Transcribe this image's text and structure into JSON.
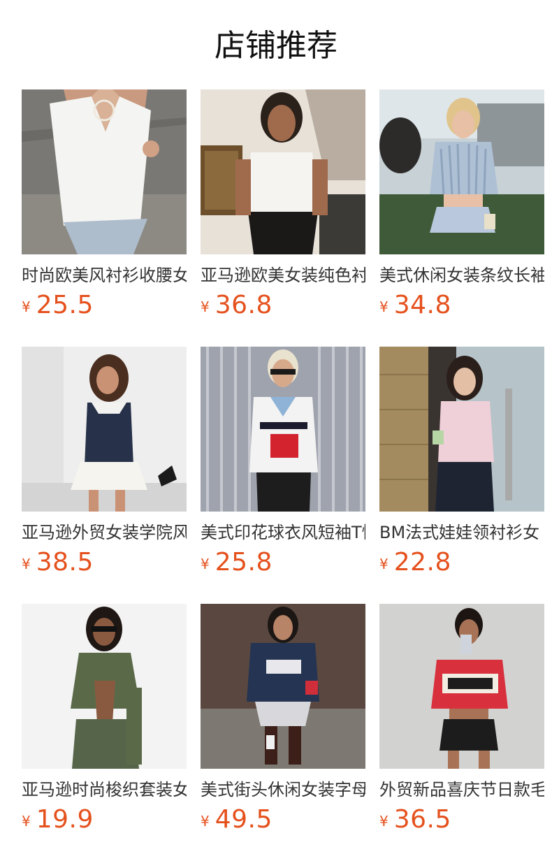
{
  "section_title": "店铺推荐",
  "currency_symbol": "¥",
  "products": [
    {
      "name": "时尚欧美风衬衫收腰女装",
      "price": "25.5",
      "image_icon": "product-photo-white-shirt"
    },
    {
      "name": "亚马逊欧美女装纯色衬衫",
      "price": "36.8",
      "image_icon": "product-photo-white-blouse"
    },
    {
      "name": "美式休闲女装条纹长袖衬衫",
      "price": "34.8",
      "image_icon": "product-photo-striped-shirt"
    },
    {
      "name": "亚马逊外贸女装学院风连衣裙",
      "price": "38.5",
      "image_icon": "product-photo-navy-dress"
    },
    {
      "name": "美式印花球衣风短袖T恤",
      "price": "25.8",
      "image_icon": "product-photo-jersey-tee"
    },
    {
      "name": "BM法式娃娃领衬衫女",
      "price": "22.8",
      "image_icon": "product-photo-pink-shirt"
    },
    {
      "name": "亚马逊时尚梭织套装女",
      "price": "19.9",
      "image_icon": "product-photo-green-set"
    },
    {
      "name": "美式街头休闲女装字母卫衣",
      "price": "49.5",
      "image_icon": "product-photo-navy-sweatshirt"
    },
    {
      "name": "外贸新品喜庆节日款毛衣",
      "price": "36.5",
      "image_icon": "product-photo-red-sweater"
    }
  ]
}
